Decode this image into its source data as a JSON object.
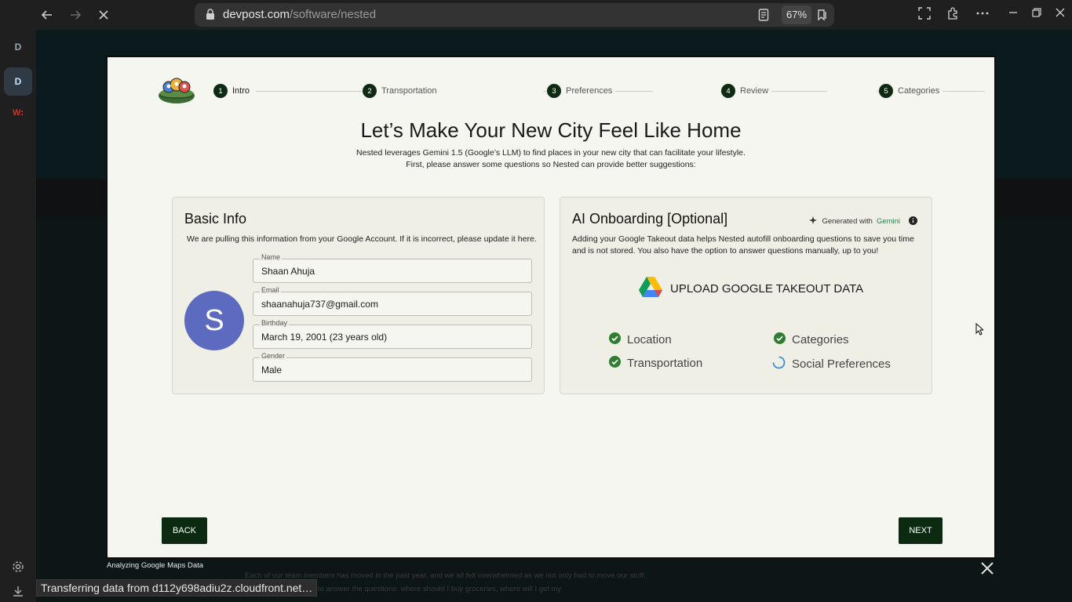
{
  "browser": {
    "url_domain": "devpost.com",
    "url_path": "/software/nested",
    "zoom": "67%"
  },
  "sidebar": {
    "items": [
      {
        "label": "D"
      },
      {
        "label": "D"
      },
      {
        "label": "W"
      }
    ]
  },
  "stepper": {
    "steps": [
      {
        "num": "1",
        "label": "Intro"
      },
      {
        "num": "2",
        "label": "Transportation"
      },
      {
        "num": "3",
        "label": "Preferences"
      },
      {
        "num": "4",
        "label": "Review"
      },
      {
        "num": "5",
        "label": "Categories"
      }
    ]
  },
  "hero": {
    "title": "Let’s Make Your New City Feel Like Home",
    "subtitle_line1": "Nested leverages Gemini 1.5 (Google’s LLM) to find places in your new city that can facilitate your lifestyle.",
    "subtitle_line2": "First, please answer some questions so Nested can provide better suggestions:"
  },
  "basic_info": {
    "heading": "Basic Info",
    "description": "We are pulling this information from your Google Account. If it is incorrect, please update it here.",
    "avatar_letter": "S",
    "fields": [
      {
        "label": "Name",
        "value": "Shaan Ahuja"
      },
      {
        "label": "Email",
        "value": "shaanahuja737@gmail.com"
      },
      {
        "label": "Birthday",
        "value": "March 19, 2001 (23 years old)"
      },
      {
        "label": "Gender",
        "value": "Male"
      }
    ]
  },
  "ai_onboarding": {
    "heading": "AI Onboarding [Optional]",
    "generated_prefix": "Generated with",
    "generated_brand": "Gemini",
    "description_line1": "Adding your Google Takeout data helps Nested autofill onboarding questions to save you time",
    "description_line2": "and is not stored. You also have the option to answer questions manually, up to you!",
    "upload_label": "UPLOAD GOOGLE TAKEOUT DATA",
    "checks": [
      {
        "label": "Location",
        "status": "done"
      },
      {
        "label": "Categories",
        "status": "done"
      },
      {
        "label": "Transportation",
        "status": "done"
      },
      {
        "label": "Social Preferences",
        "status": "loading"
      }
    ]
  },
  "buttons": {
    "back": "BACK",
    "next": "NEXT"
  },
  "footer": {
    "analyzing": "Analyzing Google Maps Data",
    "bg_line1": "Each of our team members has moved in the past year, and we all felt overwhelmed as we not only had to move our stuff,",
    "bg_line2": "and routines. We had to answer the questions: where should I buy groceries, where will I get my",
    "status": "Transferring data from d112y698adiu2z.cloudfront.net…"
  },
  "colors": {
    "primary_dark": "#0c2a12",
    "avatar": "#5c6bc0",
    "check_green": "#2e7d32",
    "modal_bg": "#f6f6f0"
  }
}
